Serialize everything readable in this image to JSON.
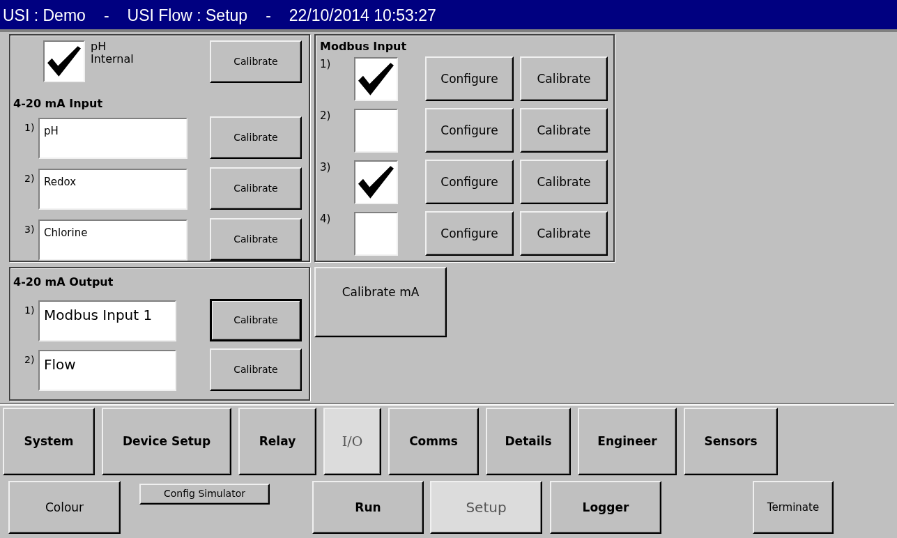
{
  "title_bar": {
    "segments": [
      "USI : Demo",
      "-",
      "USI Flow : Setup",
      "-",
      "22/10/2014 10:53:27"
    ]
  },
  "internal_sensor": {
    "label": "pH",
    "sublabel": "Internal",
    "checked": true,
    "button": "Calibrate"
  },
  "ma_input": {
    "title": "4-20 mA Input",
    "rows": [
      {
        "index": "1)",
        "value": "pH",
        "button": "Calibrate"
      },
      {
        "index": "2)",
        "value": "Redox",
        "button": "Calibrate"
      },
      {
        "index": "3)",
        "value": "Chlorine",
        "button": "Calibrate"
      }
    ]
  },
  "ma_output": {
    "title": "4-20 mA Output",
    "rows": [
      {
        "index": "1)",
        "value": "Modbus Input 1",
        "button": "Calibrate",
        "focused": true
      },
      {
        "index": "2)",
        "value": "Flow",
        "button": "Calibrate",
        "focused": false
      }
    ]
  },
  "modbus_input": {
    "title": "Modbus Input",
    "rows": [
      {
        "index": "1)",
        "checked": true,
        "configure": "Configure",
        "calibrate": "Calibrate"
      },
      {
        "index": "2)",
        "checked": false,
        "configure": "Configure",
        "calibrate": "Calibrate"
      },
      {
        "index": "3)",
        "checked": true,
        "configure": "Configure",
        "calibrate": "Calibrate"
      },
      {
        "index": "4)",
        "checked": false,
        "configure": "Configure",
        "calibrate": "Calibrate"
      }
    ]
  },
  "calibrate_ma_button": "Calibrate mA",
  "nav_tabs": [
    {
      "label": "System",
      "selected": false
    },
    {
      "label": "Device Setup",
      "selected": false
    },
    {
      "label": "Relay",
      "selected": false
    },
    {
      "label": "I/O",
      "selected": true
    },
    {
      "label": "Comms",
      "selected": false
    },
    {
      "label": "Details",
      "selected": false
    },
    {
      "label": "Engineer",
      "selected": false
    },
    {
      "label": "Sensors",
      "selected": false
    }
  ],
  "bottom_buttons": [
    {
      "label": "Colour",
      "kind": "normal",
      "selected": false
    },
    {
      "label": "Config Simulator",
      "kind": "small",
      "selected": false
    },
    {
      "label": "Run",
      "kind": "bold",
      "selected": false
    },
    {
      "label": "Setup",
      "kind": "normal",
      "selected": true
    },
    {
      "label": "Logger",
      "kind": "bold",
      "selected": false
    },
    {
      "label": "Terminate",
      "kind": "normal",
      "selected": false
    }
  ]
}
